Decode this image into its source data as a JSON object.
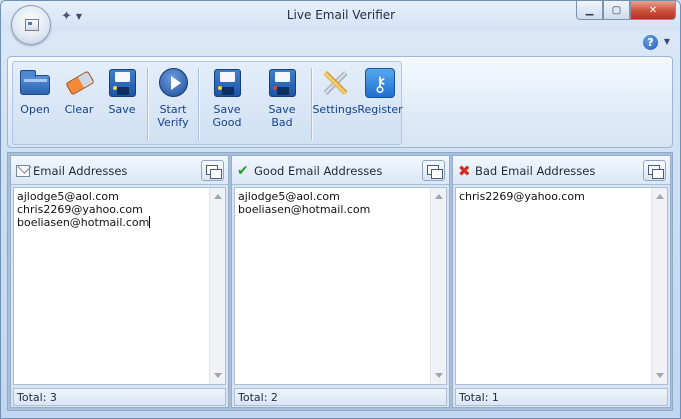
{
  "window": {
    "title": "Live Email Verifier"
  },
  "toolbar": {
    "buttons": [
      {
        "label": "Open",
        "icon": "open-folder-icon"
      },
      {
        "label": "Clear",
        "icon": "eraser-icon"
      },
      {
        "label": "Save",
        "icon": "floppy-disk-icon"
      },
      {
        "label_line1": "Start",
        "label_line2": "Verify",
        "icon": "play-icon"
      },
      {
        "label": "Save Good",
        "icon": "floppy-disk-icon"
      },
      {
        "label": "Save Bad",
        "icon": "floppy-disk-icon"
      },
      {
        "label": "Settings",
        "icon": "tools-icon"
      },
      {
        "label": "Register",
        "icon": "key-icon"
      }
    ],
    "help_glyph": "?"
  },
  "panes": {
    "all": {
      "title": "Email Addresses",
      "icon": "envelope-icon",
      "items": [
        "ajlodge5@aol.com",
        "chris2269@yahoo.com",
        "boeliasen@hotmail.com"
      ],
      "total": "Total: 3"
    },
    "good": {
      "title": "Good Email Addresses",
      "icon": "checkmark-icon",
      "items": [
        "ajlodge5@aol.com",
        "boeliasen@hotmail.com"
      ],
      "total": "Total: 2"
    },
    "bad": {
      "title": "Bad Email Addresses",
      "icon": "x-mark-icon",
      "items": [
        "chris2269@yahoo.com"
      ],
      "total": "Total: 1"
    }
  },
  "colors": {
    "ribbon_text": "#15428b",
    "good_icon": "#2a9a2a",
    "bad_icon": "#d42a1f"
  }
}
